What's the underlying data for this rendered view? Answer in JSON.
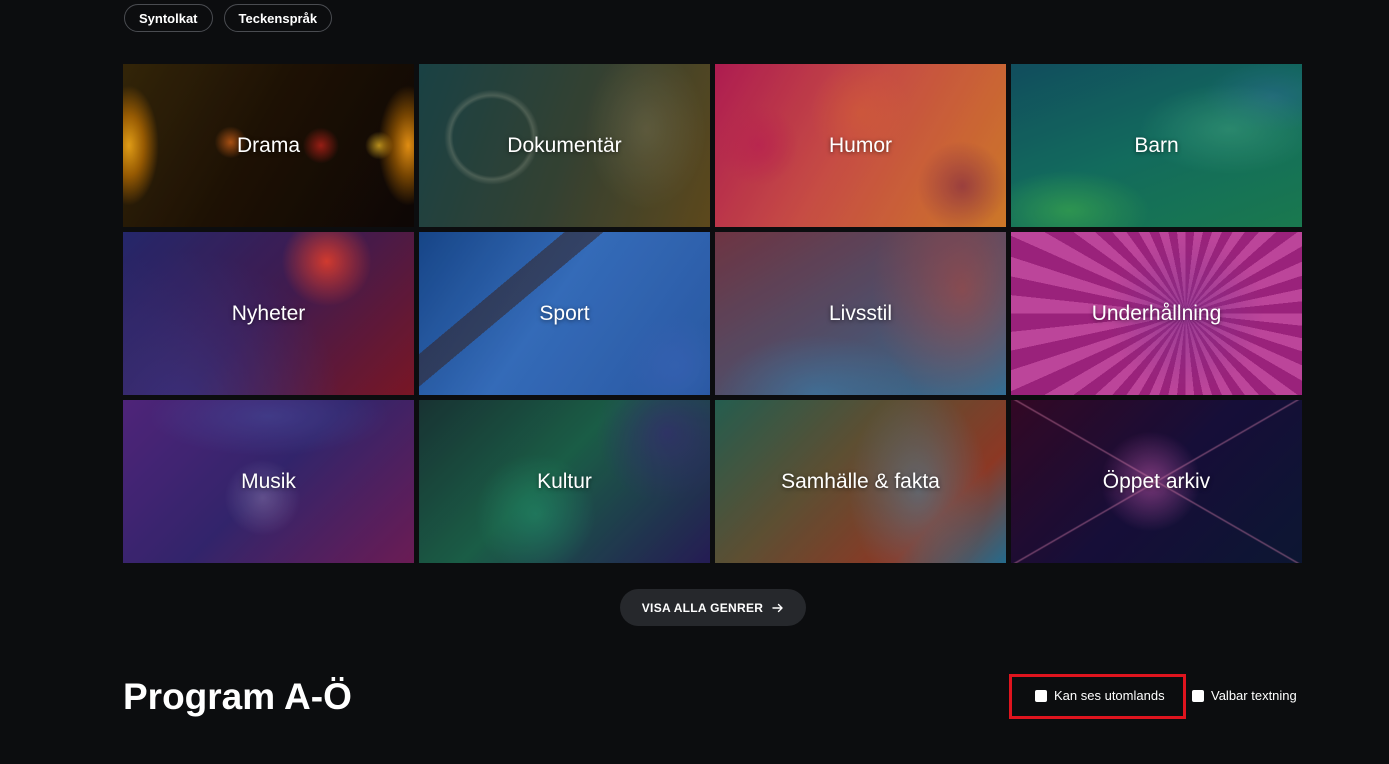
{
  "filters": {
    "chips": [
      {
        "label": "Syntolkat"
      },
      {
        "label": "Teckenspråk"
      }
    ]
  },
  "genres": [
    {
      "label": "Drama",
      "icon": "drama-image"
    },
    {
      "label": "Dokumentär",
      "icon": "documentary-image"
    },
    {
      "label": "Humor",
      "icon": "humor-image"
    },
    {
      "label": "Barn",
      "icon": "children-image"
    },
    {
      "label": "Nyheter",
      "icon": "news-image"
    },
    {
      "label": "Sport",
      "icon": "sport-image"
    },
    {
      "label": "Livsstil",
      "icon": "lifestyle-image"
    },
    {
      "label": "Underhållning",
      "icon": "entertainment-image"
    },
    {
      "label": "Musik",
      "icon": "music-image"
    },
    {
      "label": "Kultur",
      "icon": "culture-image"
    },
    {
      "label": "Samhälle & fakta",
      "icon": "society-image"
    },
    {
      "label": "Öppet arkiv",
      "icon": "archive-image"
    }
  ],
  "all_genres_button": {
    "label": "VISA ALLA GENRER",
    "icon": "arrow-right-icon"
  },
  "program_section": {
    "title": "Program A-Ö",
    "options": [
      {
        "label": "Kan ses utomlands",
        "checked": false,
        "highlighted": true
      },
      {
        "label": "Valbar textning",
        "checked": false
      }
    ]
  },
  "colors": {
    "background": "#0c0d0f",
    "button_bg": "#26282c",
    "highlight": "#e0141e"
  }
}
